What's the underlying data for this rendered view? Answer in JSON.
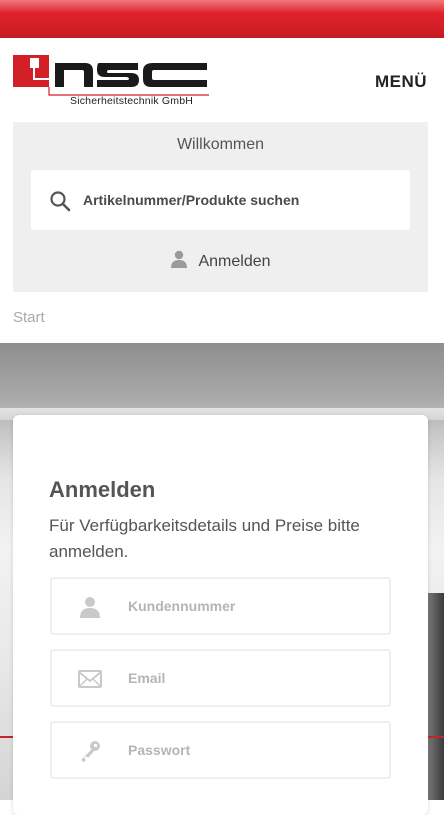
{
  "header": {
    "logo_text": "nsc",
    "logo_subtitle": "Sicherheitstechnik GmbH",
    "menu_label": "MENÜ"
  },
  "welcome": {
    "title": "Willkommen",
    "search_placeholder": "Artikelnummer/Produkte suchen",
    "login_label": "Anmelden"
  },
  "breadcrumb": {
    "current": "Start"
  },
  "login_card": {
    "title": "Anmelden",
    "description": "Für Verfügbarkeitsdetails und Preise bitte anmelden.",
    "fields": [
      {
        "placeholder": "Kundennummer",
        "icon": "user-icon"
      },
      {
        "placeholder": "Email",
        "icon": "envelope-icon"
      },
      {
        "placeholder": "Passwort",
        "icon": "key-icon"
      }
    ]
  },
  "colors": {
    "brand_red": "#d31f27",
    "panel_gray": "#efefef",
    "text_gray": "#555555"
  }
}
